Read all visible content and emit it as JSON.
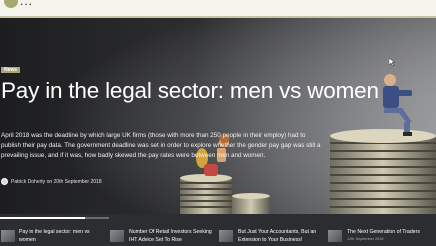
{
  "header": {
    "logo_text": "...",
    "logo_colors": {
      "mark": "#a6a86f",
      "text": "#1b1b1b"
    }
  },
  "hero": {
    "category": "News",
    "title": "Pay in the legal sector: men vs women",
    "excerpt": "April 2018 was the deadline by which large UK firms (those with more than 250 people in their employ) had to publish their pay data. The government deadline was set in order to explore whether the gender pay gap was still a prevailing issue, and if it was, how badly skewed the pay rates were between men and women.",
    "byline": "Patrick Doherty on 20th September 2018",
    "accent_color": "#a9a575"
  },
  "slider": {
    "progress": 0.78,
    "items": [
      {
        "title": "Pay in the legal sector: men vs women",
        "date": "",
        "thumb_icon": "thumbnail-image",
        "active": true
      },
      {
        "title": "Number Of Retail Investors Seeking IHT Advice Set To Rise",
        "date": "",
        "thumb_icon": "thumbnail-image",
        "active": false
      },
      {
        "title": "But Just Your Accountants, But an Extension to Your Business!",
        "date": "",
        "thumb_icon": "thumbnail-image",
        "active": false
      },
      {
        "title": "The Next Generation of Traders",
        "date": "12th September 2018",
        "thumb_icon": "thumbnail-image",
        "active": false
      }
    ]
  },
  "cursor": {
    "icon": "mouse-pointer-icon"
  }
}
